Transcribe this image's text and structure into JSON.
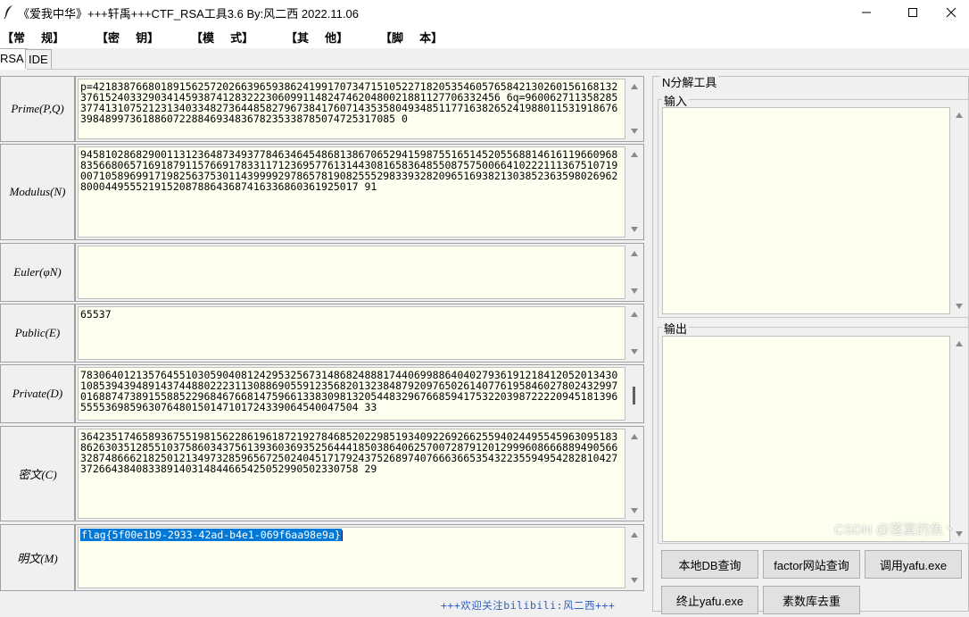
{
  "window": {
    "title": "《爱我中华》+++轩禹+++CTF_RSA工具3.6   By:风二西 2022.11.06"
  },
  "menu": {
    "items": [
      "【常    规】",
      "【密    钥】",
      "【模    式】",
      "【其    他】",
      "【脚    本】"
    ]
  },
  "tabs": [
    "RSA",
    "IDE"
  ],
  "fields": {
    "prime": {
      "label": "Prime(P,Q)",
      "value": "p=421838766801891562572026639659386241991707347151052271820535460576584213026015616813237615240332903414593874128322230609911482474620480021881127706332456 6q=960062711358285377413107521231340334827364485827967384176071435358049348511771638265241988011531918676398489973618860722884693483678235338785074725317085 0"
    },
    "modulus": {
      "label": "Modulus(N)",
      "value": "945810286829001131236487349377846346454868138670652941598755165145205568814616119660968835668065716918791157669178331171236957761314430816583648550875750066410222111367510719007105896991719825637530114399992978657819082555298339328209651693821303852363598026962800044955521915208788643687416336860361925017 91"
    },
    "euler": {
      "label": "Euler(φN)",
      "value": ""
    },
    "public": {
      "label": "Public(E)",
      "value": "65537"
    },
    "private": {
      "label": "Private(D)",
      "value": "783064012135764551030590408124295325673148682488817440699886404027936191218412052013430108539439489143744880222311308869055912356820132384879209765026140776195846027802432997016887473891558852296846766814759661338309813205448329676685941753220398722220945181396555536985963076480150147101724339064540047504 33"
    },
    "ciphertext": {
      "label": "密文(C)",
      "value": "364235174658936755198156228619618721927846852022985193409226926625594024495545963095183862630351285510375860343756139360369352564441850386406257007287912012999608666889490566328748666218250121349732859656725024045171792437526897407666366535432235594954282810427372664384083389140314844665425052990502330758 29"
    },
    "plaintext": {
      "label": "明文(M)",
      "value": "flag{5f00e1b9-2933-42ad-b4e1-069f6aa98e9a}"
    }
  },
  "footer": "+++欢迎关注bilibili:风二西+++",
  "nfactor": {
    "title": "N分解工具",
    "input_label": "输入",
    "output_label": "输出",
    "buttons": [
      "本地DB查询",
      "factor网站查询",
      "调用yafu.exe",
      "终止yafu.exe",
      "素数库去重"
    ]
  },
  "watermark": "CSDN @落寞的魚丶",
  "colors": {
    "text_area_bg": "#fffff0",
    "window_bg": "#f0f0f0",
    "selection": "#0078d7",
    "footer_text": "#3060c0"
  }
}
